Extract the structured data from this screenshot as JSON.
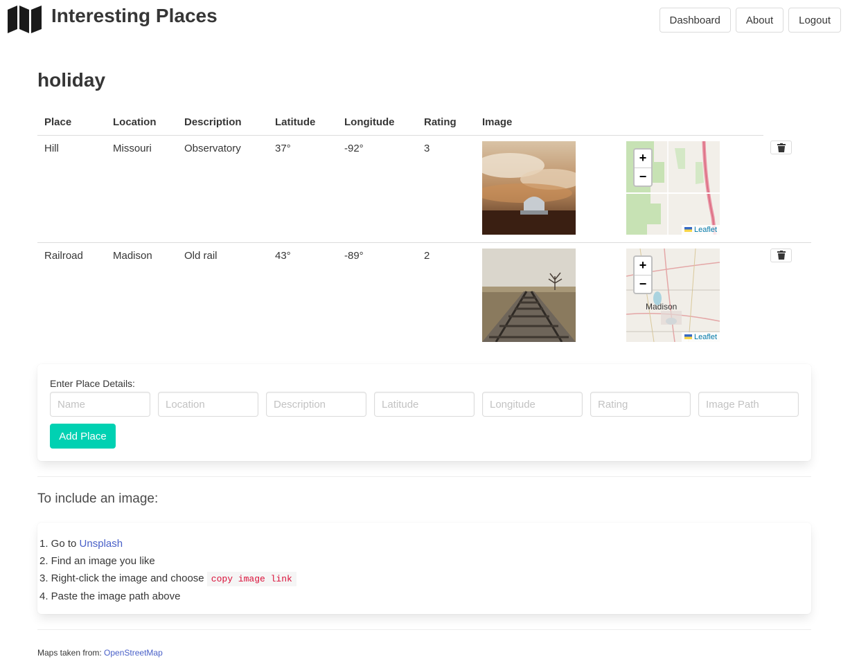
{
  "header": {
    "title": "Interesting Places",
    "logo_icon": "map-icon",
    "nav": [
      "Dashboard",
      "About",
      "Logout"
    ]
  },
  "page_title": "holiday",
  "table": {
    "columns": [
      "Place",
      "Location",
      "Description",
      "Latitude",
      "Longitude",
      "Rating",
      "Image"
    ],
    "rows": [
      {
        "place": "Hill",
        "location": "Missouri",
        "description": "Observatory",
        "latitude": "37°",
        "longitude": "-92°",
        "rating": "3",
        "map_attrib": "Leaflet",
        "map_label": ""
      },
      {
        "place": "Railroad",
        "location": "Madison",
        "description": "Old rail",
        "latitude": "43°",
        "longitude": "-89°",
        "rating": "2",
        "map_attrib": "Leaflet",
        "map_label": "Madison"
      }
    ],
    "zoom_in": "+",
    "zoom_out": "−"
  },
  "form": {
    "label": "Enter Place Details:",
    "placeholders": {
      "name": "Name",
      "location": "Location",
      "description": "Description",
      "latitude": "Latitude",
      "longitude": "Longitude",
      "rating": "Rating",
      "image": "Image Path"
    },
    "submit": "Add Place",
    "accent": "#00d1b2"
  },
  "instructions": {
    "title": "To include an image:",
    "step1_prefix": "1. Go to ",
    "step1_link": "Unsplash",
    "step2": "2. Find an image you like",
    "step3_prefix": "3. Right-click the image and choose ",
    "step3_code": "copy image link",
    "step4": "4. Paste the image path above"
  },
  "footer": {
    "prefix": "Maps taken from: ",
    "link": "OpenStreetMap"
  }
}
